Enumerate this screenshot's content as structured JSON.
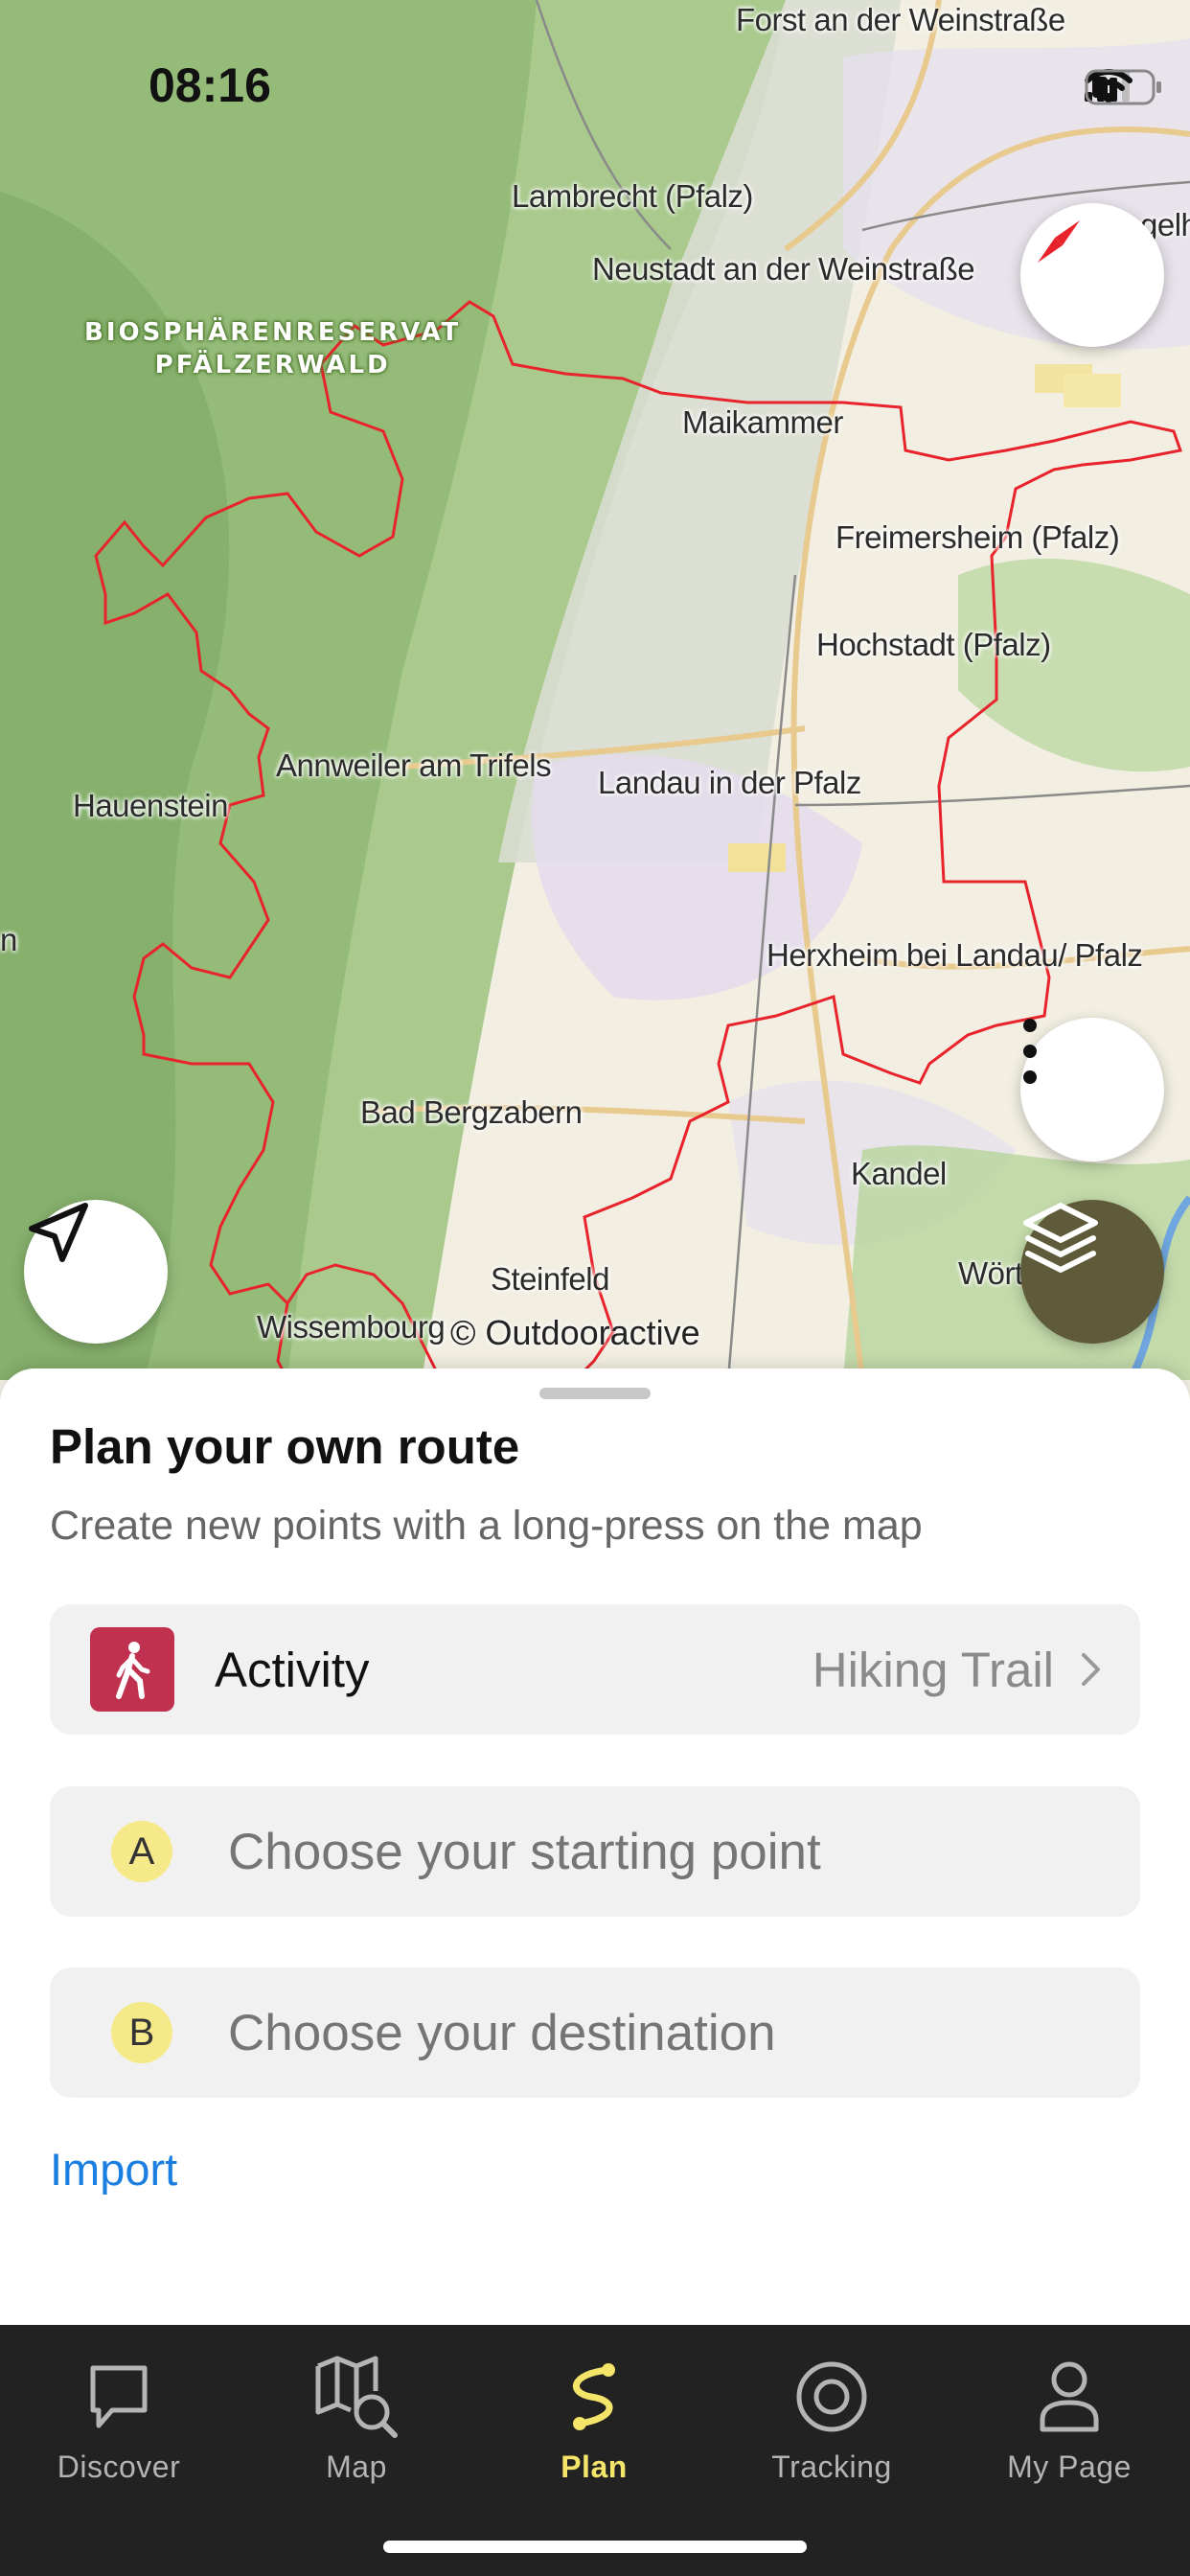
{
  "status_bar": {
    "time": "08:16"
  },
  "map": {
    "region_label_lines": [
      "BIOSPHÄRENRESERVAT",
      "PFÄLZERWALD"
    ],
    "places": [
      "Forst an der Weinstraße",
      "Lambrecht (Pfalz)",
      "Neustadt an der Weinstraße",
      "Maikammer",
      "Freimersheim (Pfalz)",
      "Hochstadt (Pfalz)",
      "Annweiler am Trifels",
      "Landau in der Pfalz",
      "Hauenstein",
      "Herxheim bei Landau/ Pfalz",
      "Bad Bergzabern",
      "Kandel",
      "Steinfeld",
      "Wissembourg",
      "Wört",
      "gelh",
      "n"
    ],
    "attribution": "© Outdooractive",
    "icons": {
      "compass": "compass-icon",
      "more": "more-vertical-icon",
      "location": "location-arrow-icon",
      "layers": "layers-icon"
    },
    "colors": {
      "boundary": "#e8232b",
      "layers_button": "#5e5a3a"
    }
  },
  "sheet": {
    "title": "Plan your own route",
    "subtitle": "Create new points with a long-press on the map",
    "activity": {
      "label": "Activity",
      "value": "Hiking Trail",
      "icon": "hiker-icon",
      "icon_color": "#c0314f"
    },
    "start": {
      "badge": "A",
      "placeholder": "Choose your starting point"
    },
    "destination": {
      "badge": "B",
      "placeholder": "Choose your destination"
    },
    "import_label": "Import"
  },
  "tabbar": {
    "active": "Plan",
    "active_color": "#f4e46a",
    "tabs": [
      {
        "label": "Discover",
        "icon": "discover-icon"
      },
      {
        "label": "Map",
        "icon": "map-search-icon"
      },
      {
        "label": "Plan",
        "icon": "route-plan-icon"
      },
      {
        "label": "Tracking",
        "icon": "tracking-icon"
      },
      {
        "label": "My Page",
        "icon": "profile-icon"
      }
    ]
  }
}
